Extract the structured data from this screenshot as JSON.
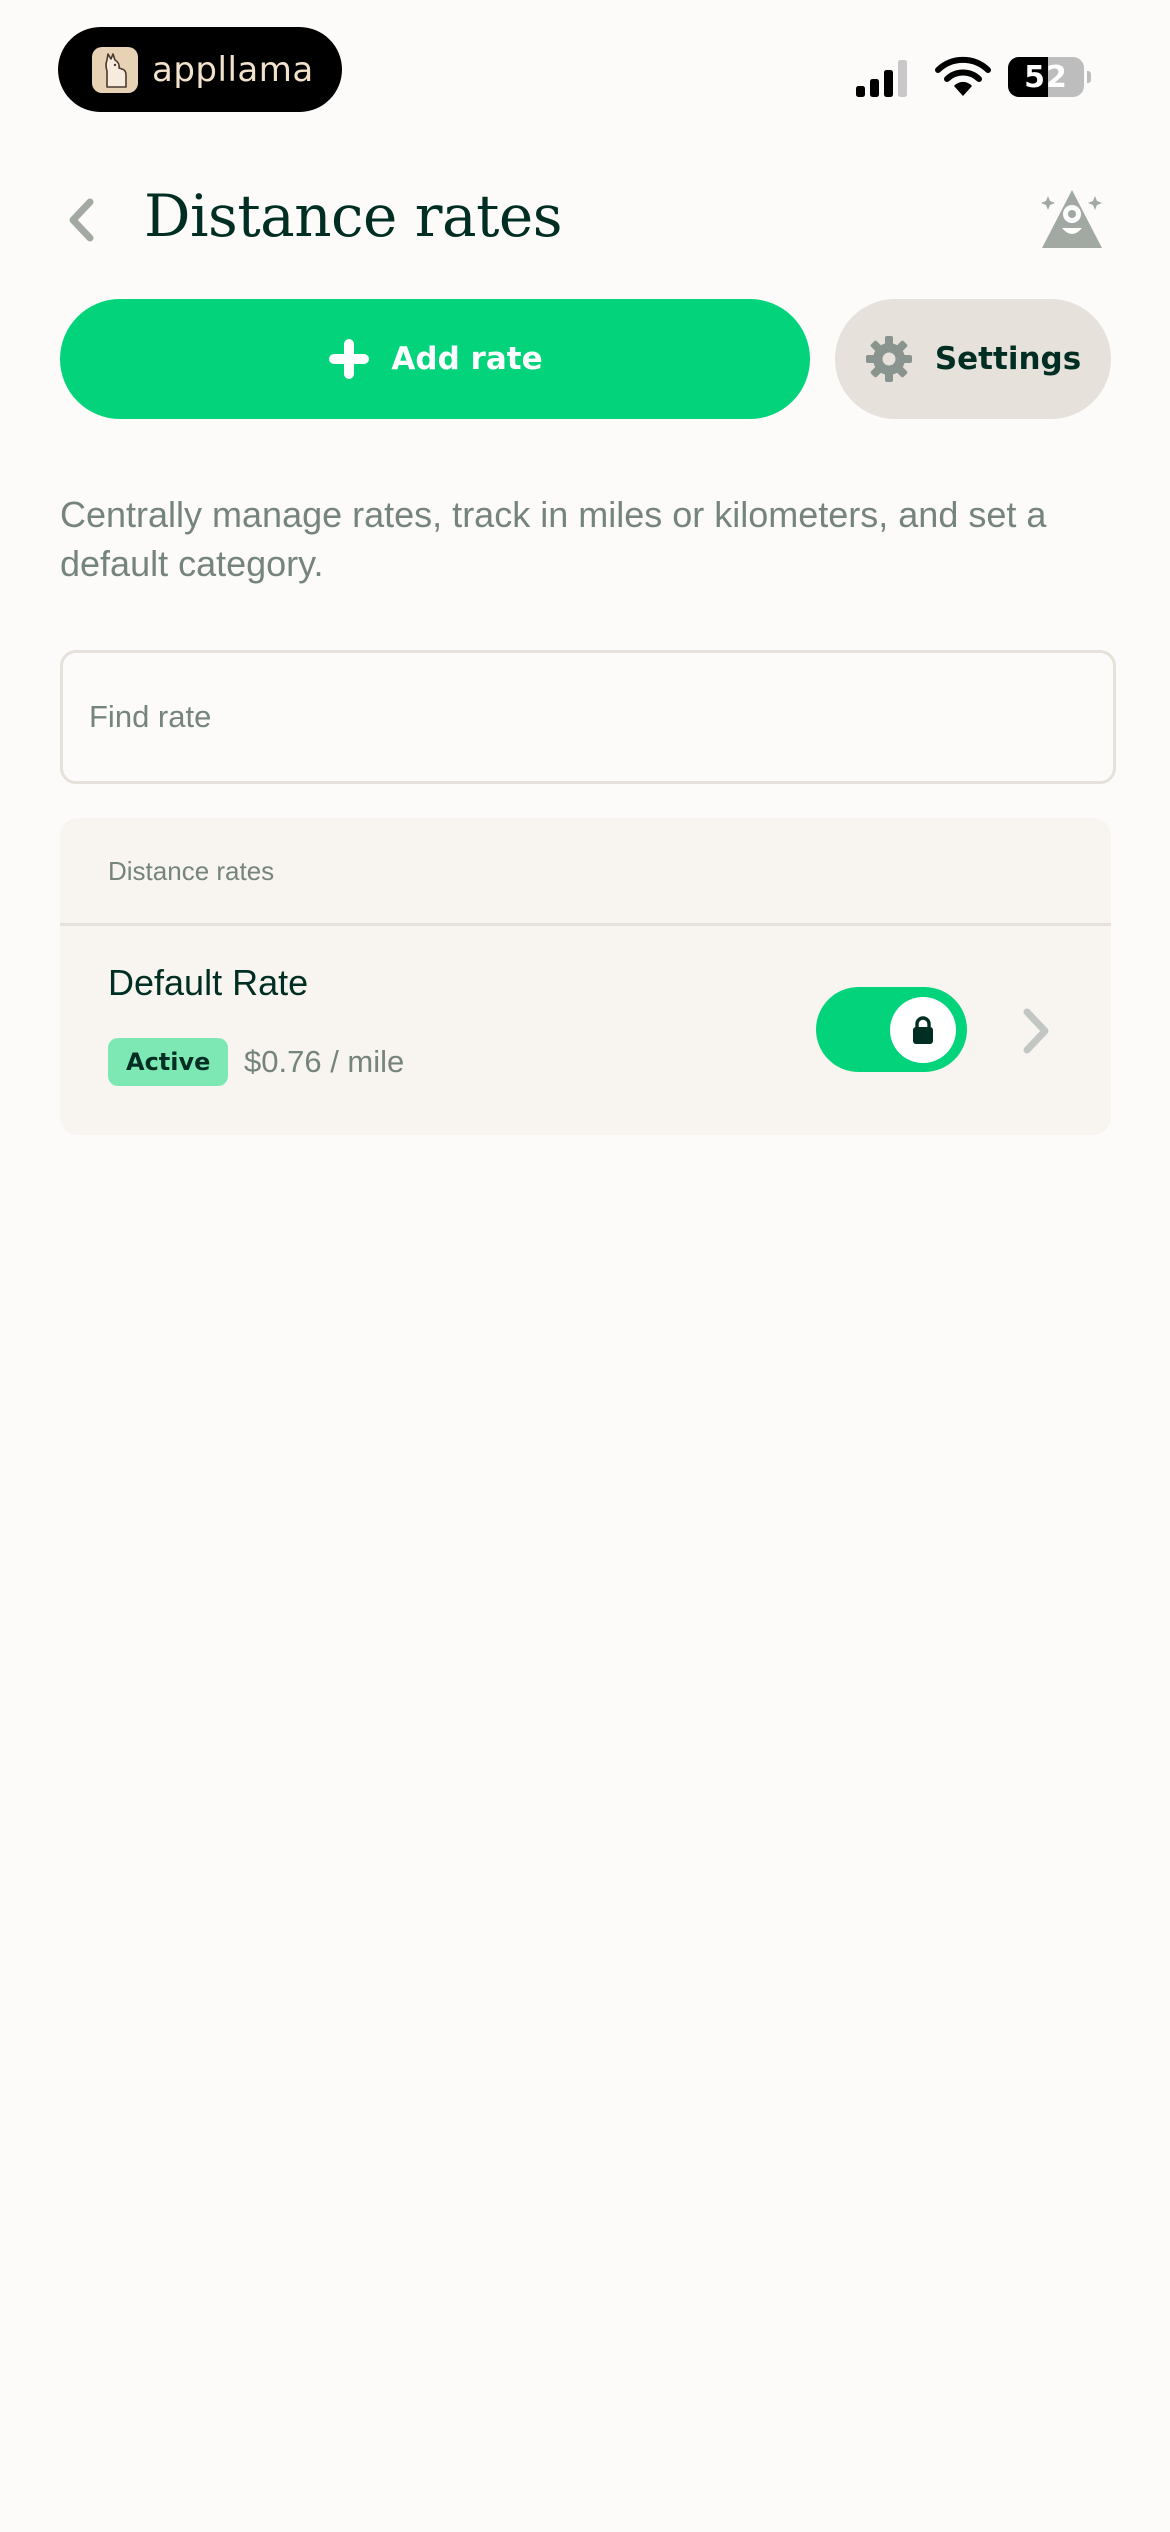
{
  "status_bar": {
    "app_name": "appllama",
    "battery_level": "52",
    "battery_fraction": 0.52
  },
  "header": {
    "title": "Distance rates",
    "back_icon": "chevron-left-icon",
    "avatar_icon": "emoji-triangle-icon"
  },
  "actions": {
    "add_rate_label": "Add rate",
    "settings_label": "Settings",
    "add_icon": "plus-icon",
    "settings_icon": "gear-icon"
  },
  "description": "Centrally manage rates, track in miles or kilometers, and set a default category.",
  "search": {
    "placeholder": "Find rate",
    "value": ""
  },
  "rates_list": {
    "header": "Distance rates",
    "items": [
      {
        "name": "Default Rate",
        "status": "Active",
        "rate": "$0.76 / mile",
        "enabled": true,
        "locked": true
      }
    ]
  },
  "colors": {
    "accent_green": "#03D47C",
    "badge_green": "#7EE8B5",
    "text_dark": "#002E22",
    "text_muted": "#76847E",
    "background": "#FCFBF9",
    "card_bg": "#F8F4F0",
    "border": "#E6E1DA"
  }
}
